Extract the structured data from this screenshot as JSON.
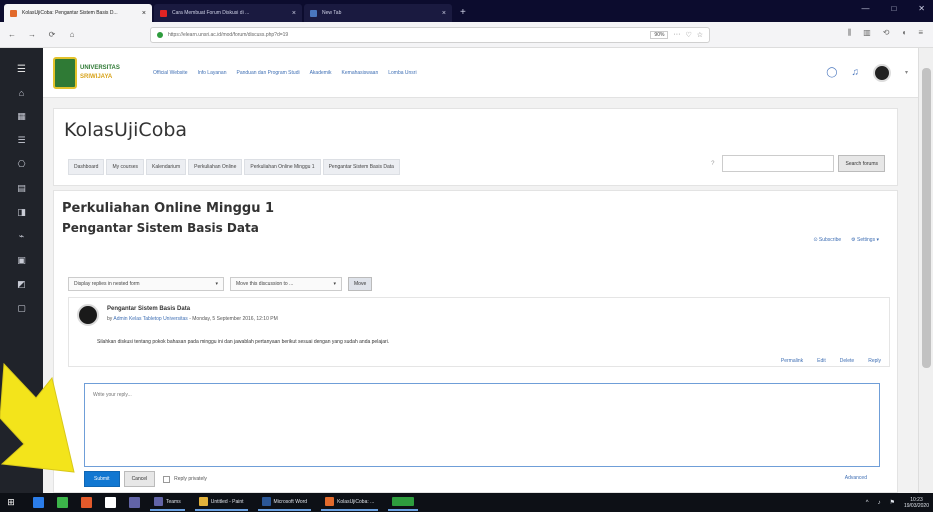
{
  "browser": {
    "tabs": [
      {
        "label": "KolasUjiCoba: Pengantar Sistem Basis D...",
        "color": "#e26a2c",
        "active": true
      },
      {
        "label": "Cara Membuat Forum Diskusi di ...",
        "color": "#e02424",
        "active": false
      },
      {
        "label": "New Tab",
        "color": "#4a76bd",
        "active": false
      }
    ],
    "new_tab": "+",
    "window_controls": {
      "minimize": "—",
      "maximize": "□",
      "close": "✕"
    },
    "nav": {
      "back": "←",
      "forward": "→",
      "reload": "⟳",
      "home": "⌂"
    },
    "url": "https://elearn.unsri.ac.id/mod/forum/discuss.php?d=19",
    "zoom": "90%",
    "url_icons": [
      "···",
      "♡",
      "☆"
    ],
    "right_icons": [
      "⫼",
      "▥",
      "⟲",
      "◖",
      "≡"
    ]
  },
  "drawer": {
    "menu_icon": "☰",
    "icons": [
      "⌂",
      "▦",
      "☰",
      "⎔",
      "▤",
      "◨",
      "⌁",
      "▣",
      "◩",
      "▢"
    ]
  },
  "header": {
    "logo_line1": "UNIVERSITAS",
    "logo_line2": "SRIWIJAYA",
    "menu": [
      "Official Website",
      "Info Layanan",
      "Panduan dan Program Studi",
      "Akademik",
      "Kemahasiswaan",
      "Lomba Unsri"
    ],
    "icons": {
      "chat": "◯",
      "bell": "♫"
    },
    "caret": "▾"
  },
  "course": {
    "title": "KolasUjiCoba",
    "tabs": [
      "Dashboard",
      "My courses",
      "Kalendarium",
      "Perkuliahan Online",
      "Perkuliahan Online Minggu 1",
      "Pengantar Sistem Basis Data"
    ],
    "search_placeholder": "",
    "search_icon": "?",
    "search_button": "Search forums"
  },
  "forum": {
    "title": "Perkuliahan Online Minggu 1",
    "subtitle": "Pengantar Sistem Basis Data",
    "links": [
      "Subscribe",
      "Settings"
    ],
    "display_mode": "Display replies in nested form",
    "move_select": "Move this discussion to ...",
    "move_button": "Move"
  },
  "post": {
    "subject": "Pengantar Sistem Basis Data",
    "by_prefix": "by",
    "author": "Admin Kelas Tabletop Universitas",
    "date": "- Monday, 5 September 2016, 12:10 PM",
    "body": "Silahkan diskusi tentang pokok bahasan pada minggu ini dan jawablah pertanyaan berikut sesuai dengan yang sudah anda pelajari.",
    "commands": [
      "Permalink",
      "Edit",
      "Delete",
      "Reply"
    ]
  },
  "reply": {
    "placeholder": "Write your reply...",
    "submit": "Submit",
    "cancel": "Cancel",
    "private_label": "Reply privately",
    "advanced": "Advanced"
  },
  "taskbar": {
    "start": "⊞",
    "pinned": [
      {
        "color": "#2b7de9"
      },
      {
        "color": "#3cb54a"
      },
      {
        "color": "#e35a2b"
      },
      {
        "color": "#ffffff"
      },
      {
        "color": "#6264a7"
      }
    ],
    "apps": [
      {
        "label": "Teams",
        "color": "#6264a7"
      },
      {
        "label": "Untitled - Paint",
        "color": "#e2b23b"
      },
      {
        "label": "Microsoft Word",
        "color": "#2b5797"
      },
      {
        "label": "KolasUjiCoba: ...",
        "color": "#e26a2c"
      },
      {
        "label": "",
        "color": "#2e9c3d"
      }
    ],
    "tray": [
      "^",
      "♪",
      "⚑"
    ],
    "time": "10:23",
    "date": "19/03/2020"
  }
}
